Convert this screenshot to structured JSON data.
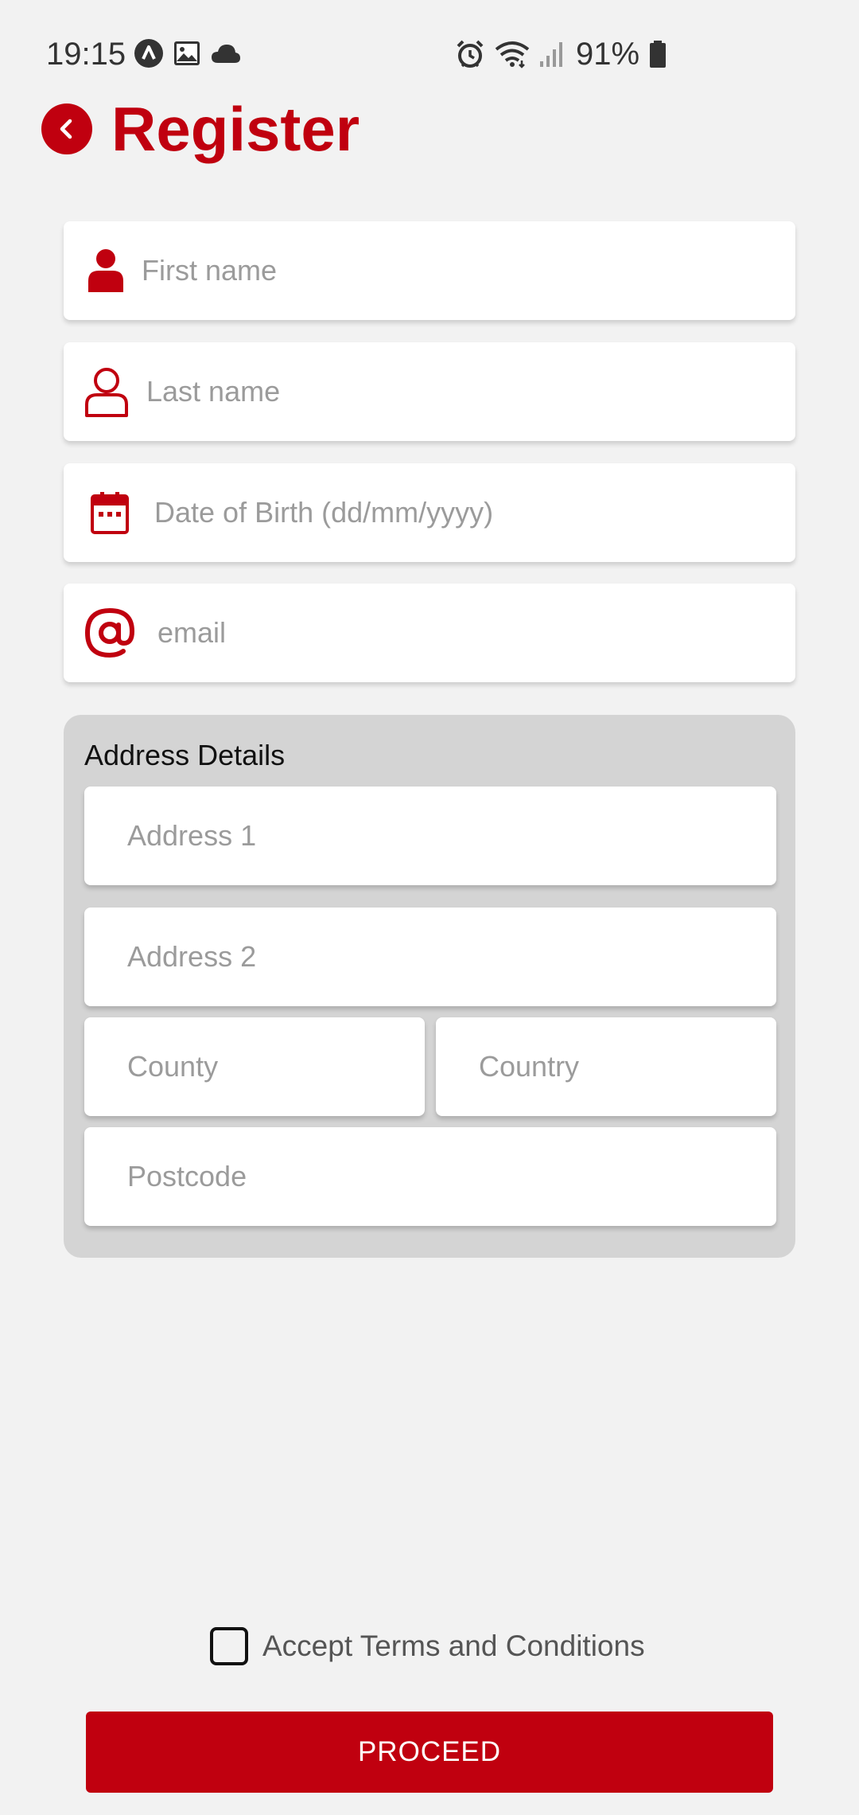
{
  "status_bar": {
    "time": "19:15",
    "battery": "91%",
    "left_icons": [
      "navigation-app-icon",
      "gallery-icon",
      "cloud-icon"
    ],
    "right_icons": [
      "alarm-icon",
      "wifi-icon",
      "signal-icon",
      "battery-icon"
    ]
  },
  "header": {
    "title": "Register",
    "back_icon": "chevron-left-icon"
  },
  "form": {
    "first_name": {
      "placeholder": "First name",
      "value": "",
      "icon": "person-filled-icon"
    },
    "last_name": {
      "placeholder": "Last name",
      "value": "",
      "icon": "person-outline-icon"
    },
    "dob": {
      "placeholder": "Date of Birth (dd/mm/yyyy)",
      "value": "",
      "icon": "calendar-icon"
    },
    "email": {
      "placeholder": "email",
      "value": "",
      "icon": "at-sign-icon"
    }
  },
  "address": {
    "title": "Address Details",
    "address1": {
      "placeholder": "Address 1",
      "value": ""
    },
    "address2": {
      "placeholder": "Address 2",
      "value": ""
    },
    "county": {
      "placeholder": "County",
      "value": ""
    },
    "country": {
      "placeholder": "Country",
      "value": ""
    },
    "postcode": {
      "placeholder": "Postcode",
      "value": ""
    }
  },
  "terms": {
    "label": "Accept Terms and Conditions",
    "checked": false
  },
  "actions": {
    "proceed_label": "PROCEED"
  },
  "colors": {
    "accent": "#c0000f",
    "background": "#f2f2f2",
    "panel": "#d4d4d4",
    "placeholder": "#9b9b9b"
  }
}
